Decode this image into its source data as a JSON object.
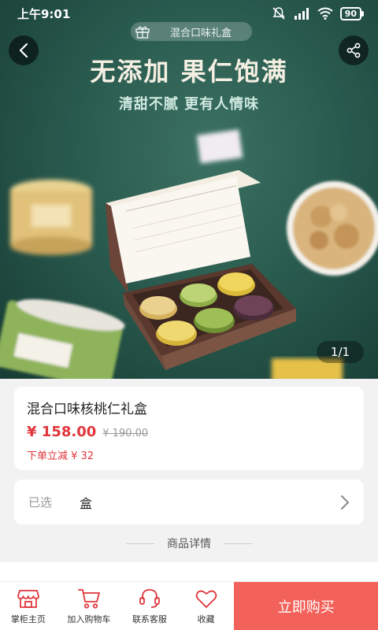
{
  "status_bar": {
    "time": "上午9:01",
    "battery": "90"
  },
  "banner": {
    "tag": "混合口味礼盒",
    "title": "无添加 果仁饱满",
    "subtitle": "清甜不腻 更有人情味",
    "counter": "1/1"
  },
  "product": {
    "name": "混合口味核桃仁礼盒",
    "price": "¥ 158.00",
    "original_price": "¥ 190.00",
    "discount": "下单立减 ¥ 32"
  },
  "spec": {
    "label": "已选",
    "value": "盒"
  },
  "details": {
    "title": "商品详情"
  },
  "bottom_bar": {
    "tabs": [
      "掌柜主页",
      "加入购物车",
      "联系客服",
      "收藏"
    ],
    "buy_label": "立即购买"
  },
  "colors": {
    "accent": "#e0363c",
    "buy_button": "#f2625a",
    "hero_bg": "#2a5b4f"
  }
}
